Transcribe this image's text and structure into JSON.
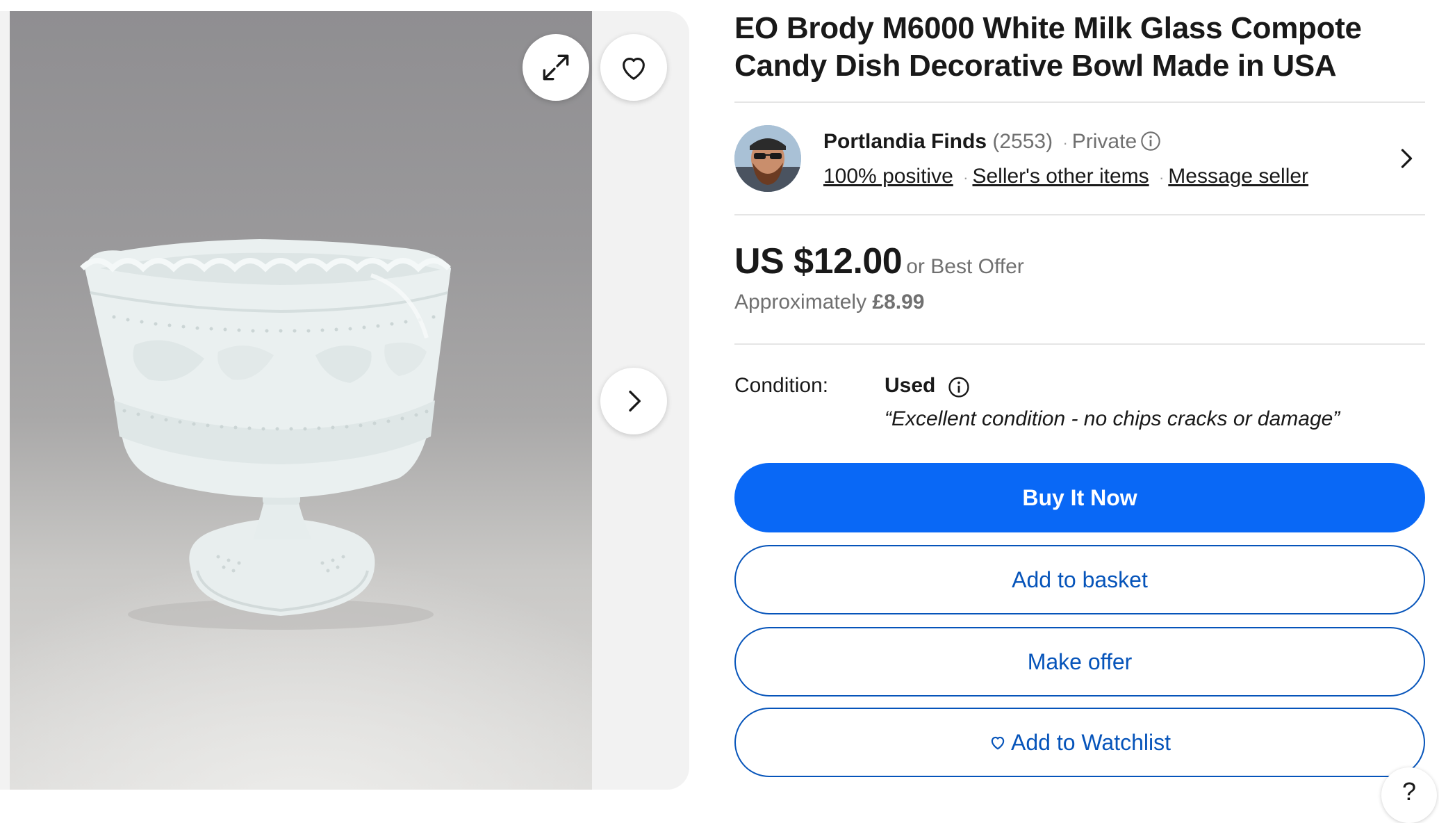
{
  "listing": {
    "title": "EO Brody M6000 White Milk Glass Compote Candy Dish Decorative Bowl Made in USA"
  },
  "gallery": {
    "image_alt": "White milk glass compote bowl",
    "icons": {
      "expand": "expand-icon",
      "favorite": "heart-icon",
      "next": "chevron-right-icon"
    }
  },
  "seller": {
    "name": "Portlandia Finds",
    "feedback_count": "(2553)",
    "separator": "·",
    "account_type": "Private",
    "positive": "100% positive",
    "other_items": "Seller's other items",
    "message": "Message seller"
  },
  "price": {
    "amount": "US $12.00",
    "best_offer": "or Best Offer",
    "approx_label": "Approximately",
    "approx_value": "£8.99"
  },
  "condition": {
    "label": "Condition:",
    "value": "Used",
    "description": "“Excellent condition - no chips cracks or damage”"
  },
  "actions": {
    "buy_now": "Buy It Now",
    "add_to_basket": "Add to basket",
    "make_offer": "Make offer",
    "add_to_watchlist": "Add to Watchlist"
  },
  "help": {
    "label": "?"
  },
  "colors": {
    "primary_blue": "#0968f6",
    "outline_blue": "#0654ba",
    "text": "#191919",
    "muted": "#707070"
  }
}
